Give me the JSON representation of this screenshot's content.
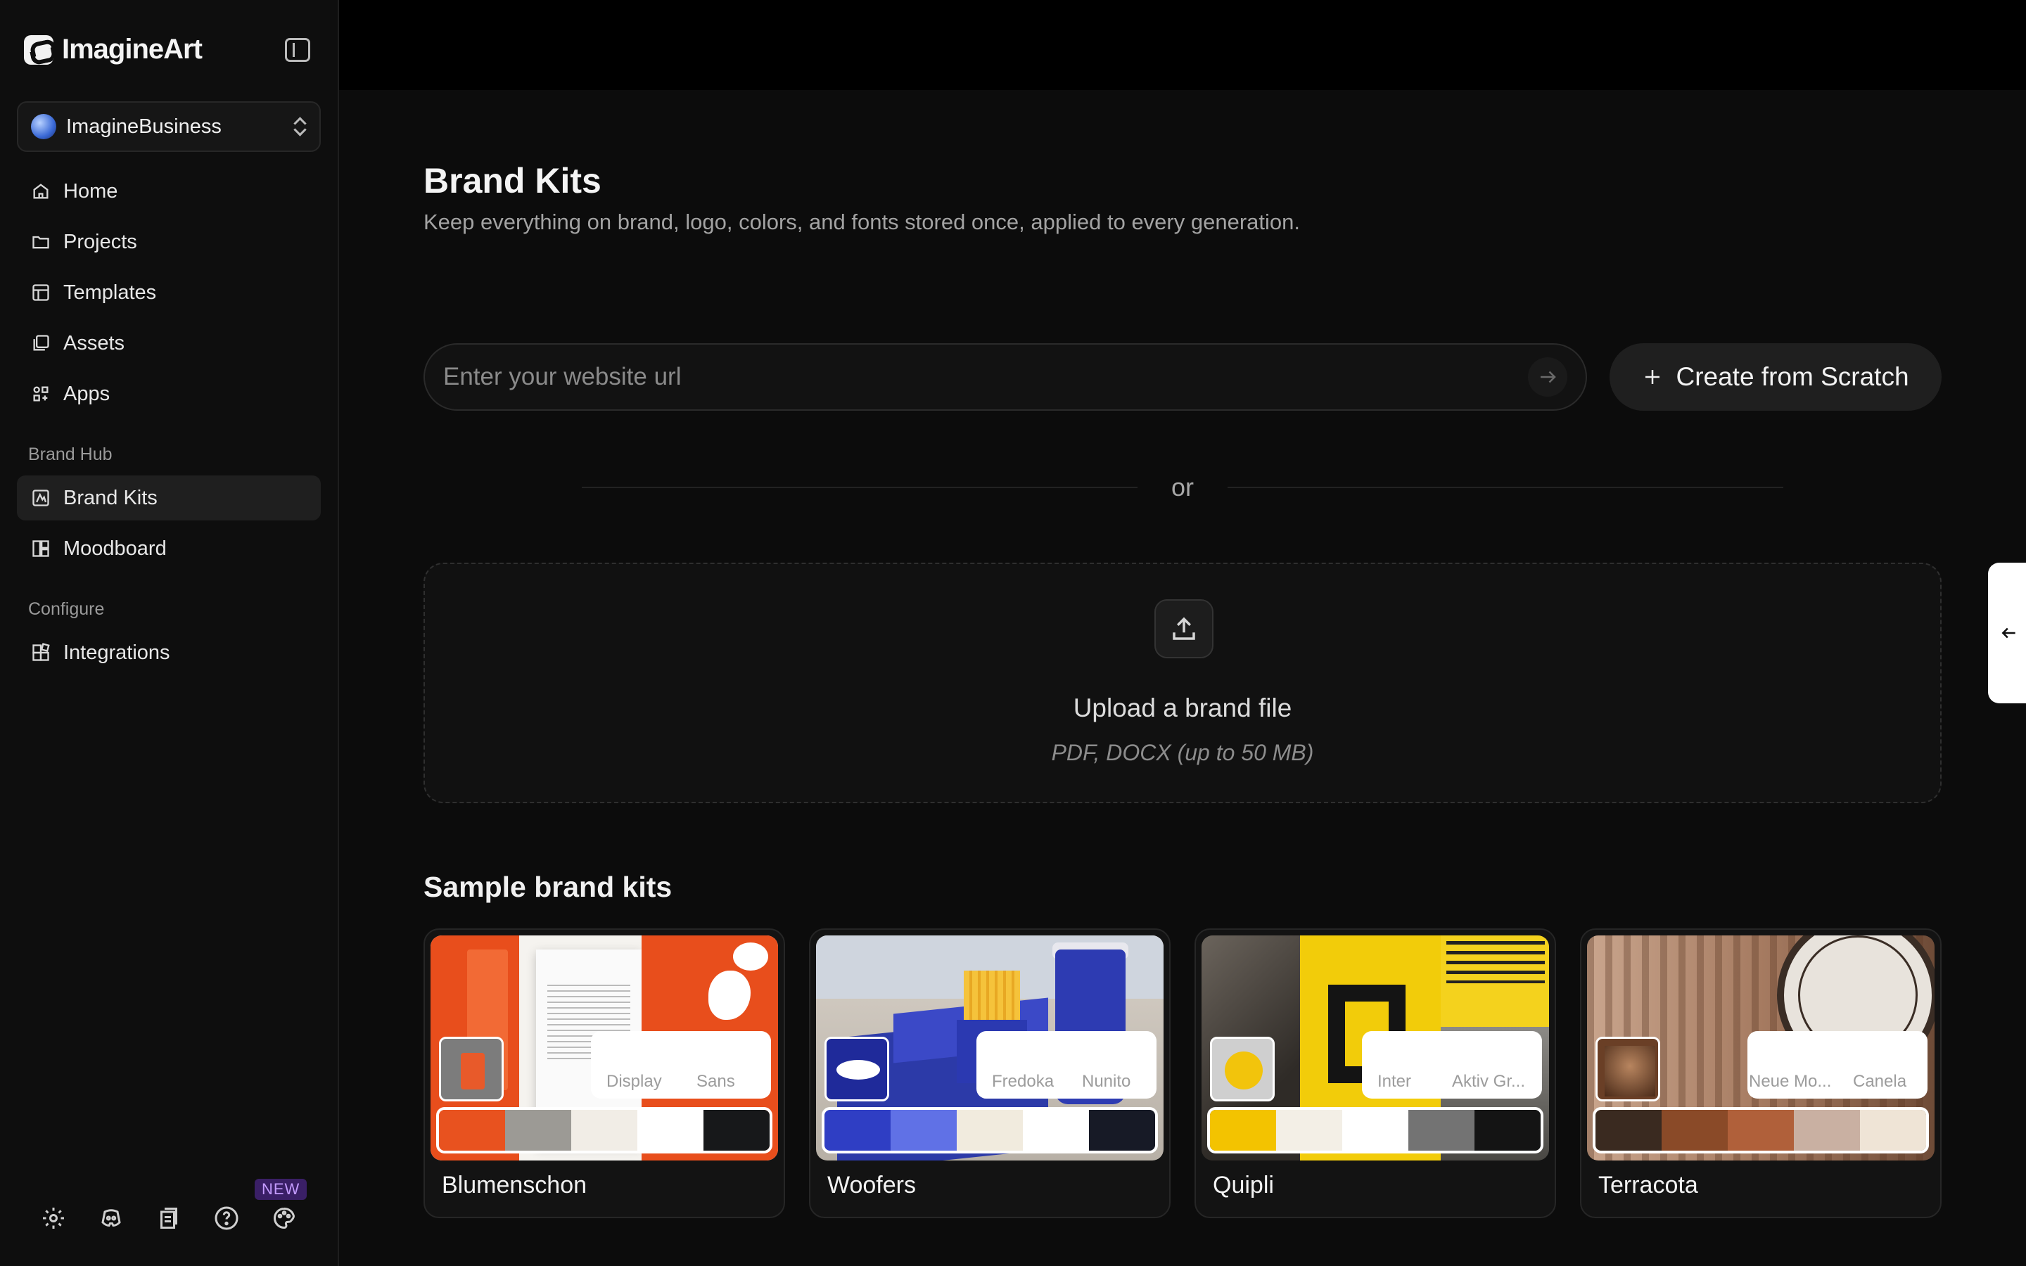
{
  "app": {
    "name": "ImagineArt"
  },
  "workspace": {
    "name": "ImagineBusiness"
  },
  "nav": {
    "main": [
      {
        "label": "Home",
        "icon": "home-icon"
      },
      {
        "label": "Projects",
        "icon": "folder-icon"
      },
      {
        "label": "Templates",
        "icon": "templates-icon"
      },
      {
        "label": "Assets",
        "icon": "assets-icon"
      },
      {
        "label": "Apps",
        "icon": "apps-icon"
      }
    ],
    "brand_hub_label": "Brand Hub",
    "brand_hub": [
      {
        "label": "Brand Kits",
        "icon": "brand-kits-icon",
        "active": true
      },
      {
        "label": "Moodboard",
        "icon": "moodboard-icon"
      }
    ],
    "configure_label": "Configure",
    "configure": [
      {
        "label": "Integrations",
        "icon": "integrations-icon"
      }
    ]
  },
  "footer": {
    "icons": [
      "settings-icon",
      "discord-icon",
      "docs-icon",
      "help-icon",
      "palette-icon"
    ],
    "new_badge": "NEW"
  },
  "page": {
    "title": "Brand Kits",
    "subtitle": "Keep everything on brand, logo, colors, and fonts stored once, applied to every generation."
  },
  "url_input": {
    "placeholder": "Enter your website url",
    "value": ""
  },
  "create_button": {
    "label": "Create from Scratch"
  },
  "divider": {
    "text": "or"
  },
  "upload": {
    "title": "Upload a brand file",
    "note": "PDF, DOCX (up to 50 MB)"
  },
  "samples": {
    "title": "Sample brand kits",
    "kits": [
      {
        "name": "Blumenschon",
        "fonts": [
          "Display",
          "Sans"
        ],
        "colors": [
          "#e8521f",
          "#9c9a95",
          "#f1ede6",
          "#ffffff",
          "#17181a"
        ]
      },
      {
        "name": "Woofers",
        "fonts": [
          "Fredoka",
          "Nunito"
        ],
        "colors": [
          "#2f3ec4",
          "#6071e6",
          "#f1ebde",
          "#ffffff",
          "#171a26"
        ]
      },
      {
        "name": "Quipli",
        "fonts": [
          "Inter",
          "Aktiv Gr..."
        ],
        "colors": [
          "#f3c300",
          "#f3efe6",
          "#ffffff",
          "#737373",
          "#141414"
        ]
      },
      {
        "name": "Terracota",
        "fonts": [
          "Neue Mo...",
          "Canela"
        ],
        "colors": [
          "#3a2a20",
          "#8a4a28",
          "#b0603a",
          "#c9b0a2",
          "#efe4d6"
        ]
      }
    ]
  }
}
